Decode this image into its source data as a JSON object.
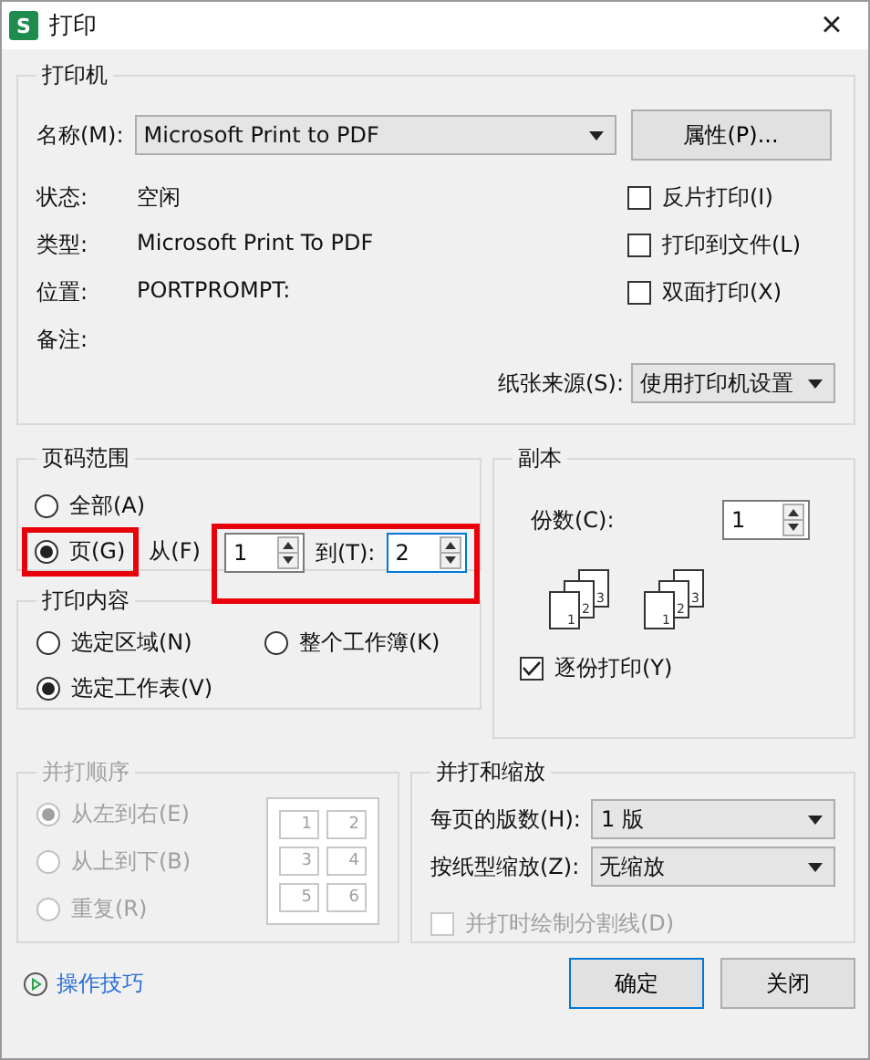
{
  "window": {
    "title": "打印",
    "app_icon": "S",
    "close": "×"
  },
  "printer": {
    "legend": "打印机",
    "name_label": "名称(M):",
    "name_value": "Microsoft Print to PDF",
    "properties_button": "属性(P)...",
    "info": [
      {
        "label": "状态:",
        "value": "空闲"
      },
      {
        "label": "类型:",
        "value": "Microsoft Print To PDF"
      },
      {
        "label": "位置:",
        "value": "PORTPROMPT:"
      },
      {
        "label": "备注:"
      }
    ],
    "options": [
      {
        "label": "反片打印(I)",
        "checked": false
      },
      {
        "label": "打印到文件(L)",
        "checked": false
      },
      {
        "label": "双面打印(X)",
        "checked": false
      }
    ],
    "source_label": "纸张来源(S):",
    "source_value": "使用打印机设置"
  },
  "page_range": {
    "legend": "页码范围",
    "options": [
      {
        "label": "全部(A)",
        "selected": false,
        "highlighted": false
      },
      {
        "label": "页(G)",
        "selected": true,
        "highlighted": true
      }
    ],
    "from_label": "从(F)",
    "from_value": "1",
    "to_label": "到(T):",
    "to_value": "2",
    "range_highlighted": true
  },
  "copies": {
    "legend": "副本",
    "count_label": "份数(C):",
    "count_value": "1",
    "stacks": [
      {
        "pages": [
          "1",
          "2",
          "3"
        ]
      },
      {
        "pages": [
          "1",
          "2",
          "3"
        ]
      }
    ],
    "collate_label": "逐份打印(Y)",
    "collate_checked": true
  },
  "print_content": {
    "legend": "打印内容",
    "options": [
      {
        "label": "选定区域(N)",
        "selected": false
      },
      {
        "label": "整个工作簿(K)",
        "selected": false
      },
      {
        "label": "选定工作表(V)",
        "selected": true
      }
    ]
  },
  "order": {
    "legend": "并打顺序",
    "disabled": true,
    "options": [
      {
        "label": "从左到右(E)",
        "selected": true
      },
      {
        "label": "从上到下(B)",
        "selected": false
      },
      {
        "label": "重复(R)",
        "selected": false
      }
    ],
    "grid": [
      "1",
      "2",
      "3",
      "4",
      "5",
      "6"
    ]
  },
  "scaling": {
    "legend": "并打和缩放",
    "rows": [
      {
        "label": "每页的版数(H):",
        "value": "1 版"
      },
      {
        "label": "按纸型缩放(Z):",
        "value": "无缩放"
      }
    ],
    "divider_label": "并打时绘制分割线(D)",
    "divider_checked": false,
    "divider_disabled": true
  },
  "footer": {
    "tips_link": "操作技巧",
    "buttons": [
      {
        "label": "确定",
        "default": true
      },
      {
        "label": "关闭",
        "default": false
      }
    ]
  }
}
